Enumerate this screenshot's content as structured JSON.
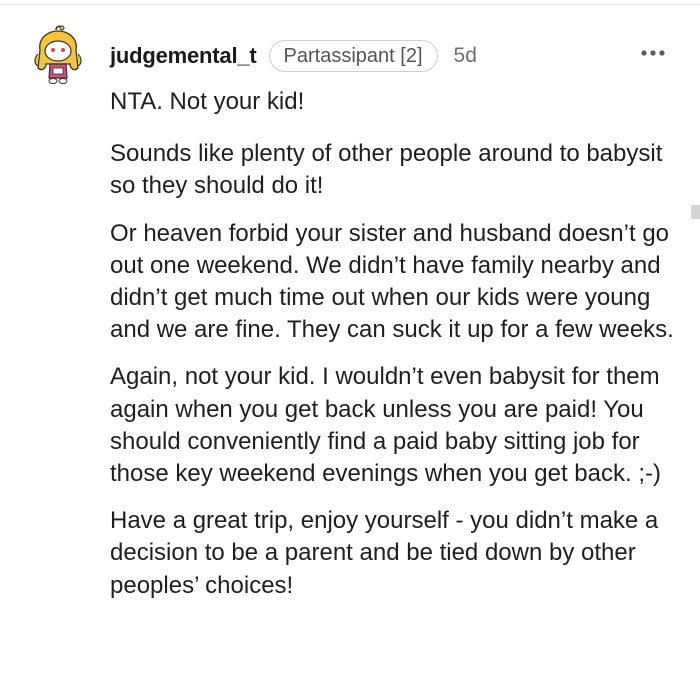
{
  "comment": {
    "username": "judgemental_t",
    "flair": "Partassipant [2]",
    "timestamp": "5d",
    "more_icon": "more-horizontal-icon",
    "avatar": "snoo-avatar-yellow-hood",
    "paragraphs": [
      "NTA. Not your kid!",
      "Sounds like plenty of other people around to babysit so they should do it!",
      "Or heaven forbid your sister and husband doesn’t go out one weekend. We didn’t have family nearby and didn’t get much time out when our kids were young and we are fine. They can suck it up for a few weeks.",
      "Again, not your kid. I wouldn’t even babysit for them again when you get back unless you are paid! You should conveniently find a paid baby sitting job for those key weekend evenings when you get back. ;-)",
      "Have a great trip, enjoy yourself - you didn’t make a decision to be a parent and be tied down by other peoples’ choices!"
    ]
  }
}
